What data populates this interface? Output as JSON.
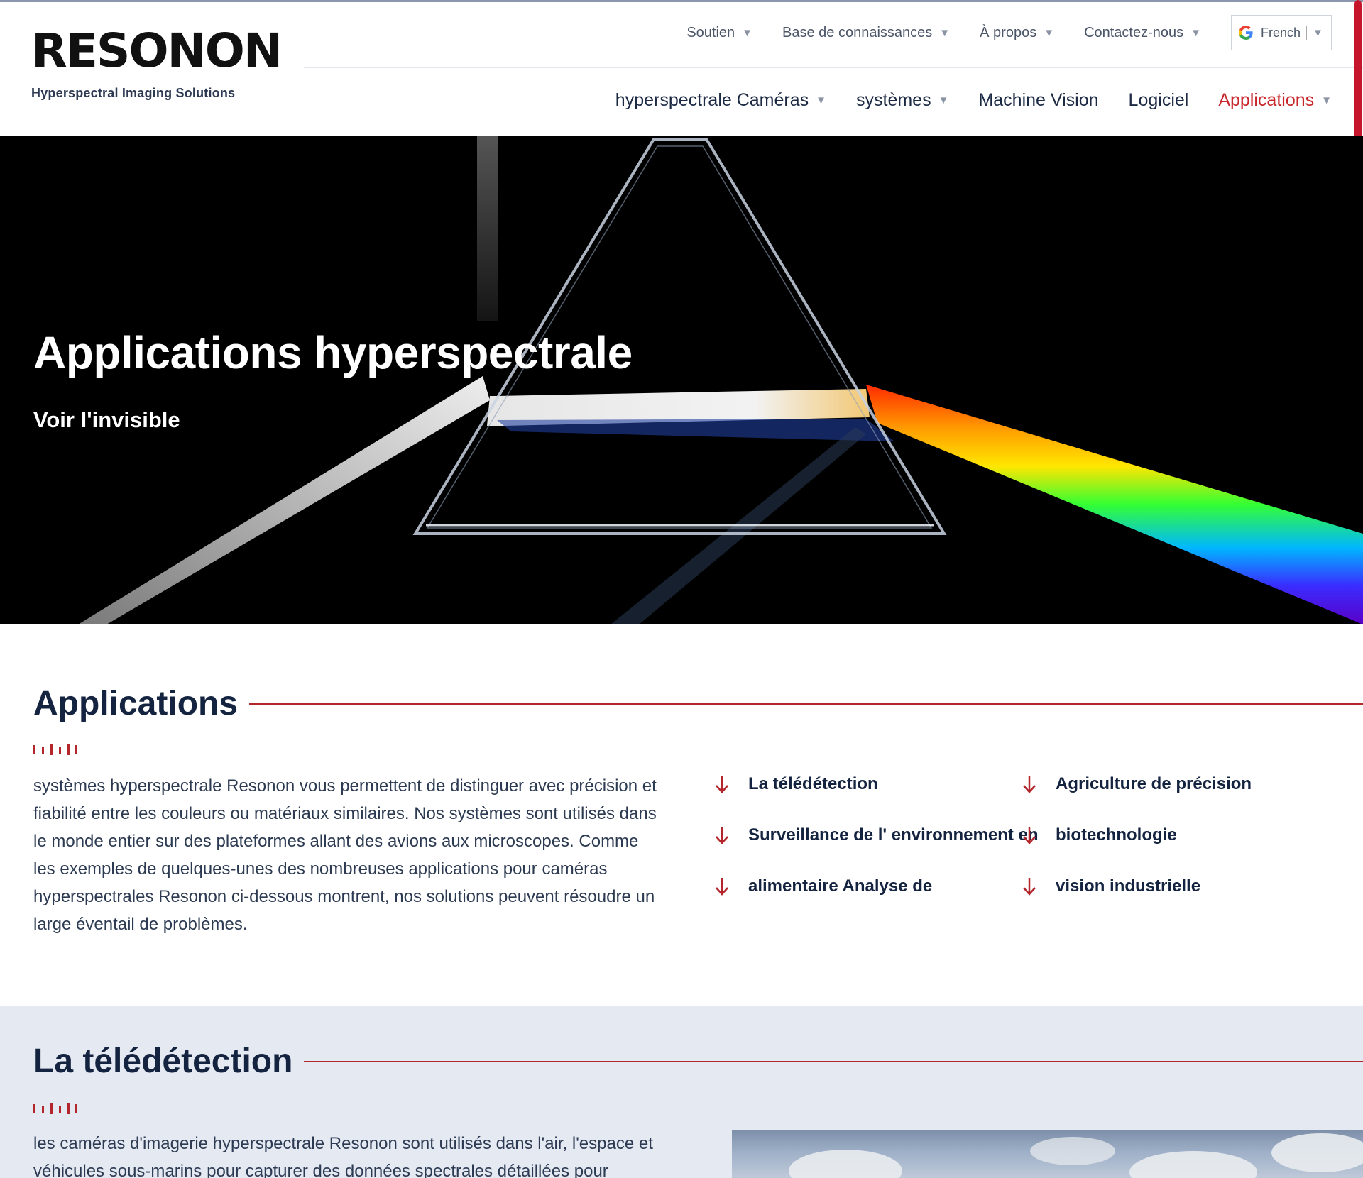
{
  "brand": {
    "name": "RESONON",
    "tagline": "Hyperspectral Imaging Solutions"
  },
  "top_nav": {
    "items": [
      {
        "label": "Soutien"
      },
      {
        "label": "Base de connaissances"
      },
      {
        "label": "À propos"
      },
      {
        "label": "Contactez-nous"
      }
    ],
    "language": "French"
  },
  "main_nav": {
    "items": [
      {
        "label": "hyperspectrale Caméras",
        "dropdown": true
      },
      {
        "label": "systèmes",
        "dropdown": true
      },
      {
        "label": "Machine Vision",
        "dropdown": false
      },
      {
        "label": "Logiciel",
        "dropdown": false
      },
      {
        "label": "Applications",
        "dropdown": true,
        "active": true
      }
    ]
  },
  "hero": {
    "title": "Applications hyperspectrale",
    "subtitle": "Voir l'invisible"
  },
  "applications": {
    "heading": "Applications",
    "text": "systèmes hyperspectrale Resonon vous permettent de distinguer avec précision et fiabilité entre les couleurs ou matériaux similaires. Nos systèmes sont utilisés dans le monde entier sur des plateformes allant des avions aux microscopes. Comme les exemples de quelques-unes des nombreuses applications pour caméras hyperspectrales Resonon ci-dessous montrent, nos solutions peuvent résoudre un large éventail de problèmes.",
    "links": [
      "La télédétection",
      "Agriculture de précision",
      "Surveillance de l' environnement en",
      "biotechnologie",
      "alimentaire Analyse de",
      "vision industrielle"
    ]
  },
  "remote_sensing": {
    "heading": "La télédétection",
    "text": "les caméras d'imagerie hyperspectrale Resonon sont utilisés dans l'air, l'espace et véhicules sous-marins pour capturer des données spectrales détaillées pour"
  },
  "colors": {
    "accent": "#c8262b",
    "navy": "#14233f",
    "light_section": "#e4e9f2"
  }
}
